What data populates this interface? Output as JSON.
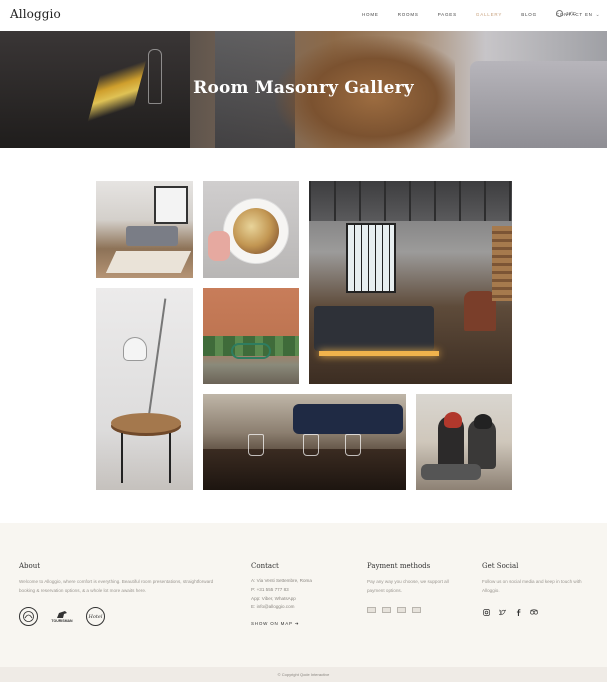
{
  "header": {
    "logo": "Alloggio",
    "nav": [
      "HOME",
      "ROOMS",
      "PAGES",
      "GALLERY",
      "BLOG",
      "CONTACT"
    ],
    "active_nav": "GALLERY",
    "weather": "13°C",
    "language": "EN"
  },
  "hero": {
    "title": "Room Masonry Gallery"
  },
  "footer": {
    "about": {
      "title": "About",
      "text": "Welcome to Alloggio, where comfort is everything. Beautiful room presentations, straightforward booking & reservation options, & a whole lot more awaits here.",
      "awards": [
        "Emblem",
        "TOURISMAN",
        "Hotel"
      ]
    },
    "contact": {
      "title": "Contact",
      "lines": [
        "A: Via Venti Settembre, Roma",
        "P: +31 555 777 83",
        "App: Viber, WhatsApp",
        "E: info@alloggio.com"
      ],
      "show_map": "SHOW ON MAP"
    },
    "payment": {
      "title": "Payment methods",
      "text": "Pay any way you choose, we support all payment options."
    },
    "social": {
      "title": "Get Social",
      "text": "Follow us on social media and keep in touch with Alloggio."
    },
    "copyright": "© Copyright Qode Interactive"
  },
  "colors": {
    "accent": "#c7a07c",
    "footer_bg": "#f8f6f1",
    "copyright_bg": "#efebe6"
  }
}
